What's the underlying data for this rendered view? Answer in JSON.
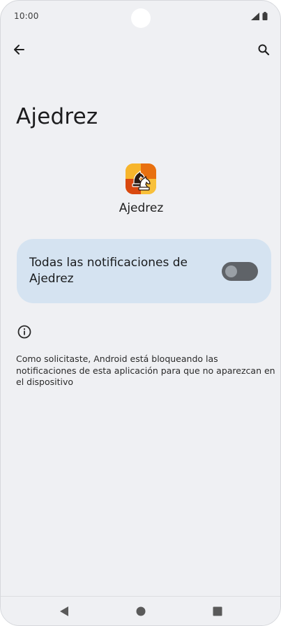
{
  "status_bar": {
    "time": "10:00",
    "icons": [
      "signal-icon",
      "battery-icon"
    ]
  },
  "header": {
    "back_icon": "arrow-left-icon",
    "search_icon": "search-icon",
    "title": "Ajedrez"
  },
  "app": {
    "name": "Ajedrez",
    "icon": "chess-app-icon"
  },
  "notifications_toggle": {
    "label": "Todas las notificaciones de Ajedrez",
    "state": "off"
  },
  "info": {
    "icon": "info-icon",
    "text": "Como solicitaste, Android está bloqueando las notificaciones de esta aplicación para que no aparezcan en el dispositivo"
  },
  "nav_bar": {
    "buttons": [
      "back-triangle-icon",
      "home-circle-icon",
      "recents-square-icon"
    ]
  },
  "colors": {
    "background": "#eff0f3",
    "card": "#d5e3f1",
    "switch_track": "#5f6368",
    "switch_knob": "#9aa0a6"
  }
}
